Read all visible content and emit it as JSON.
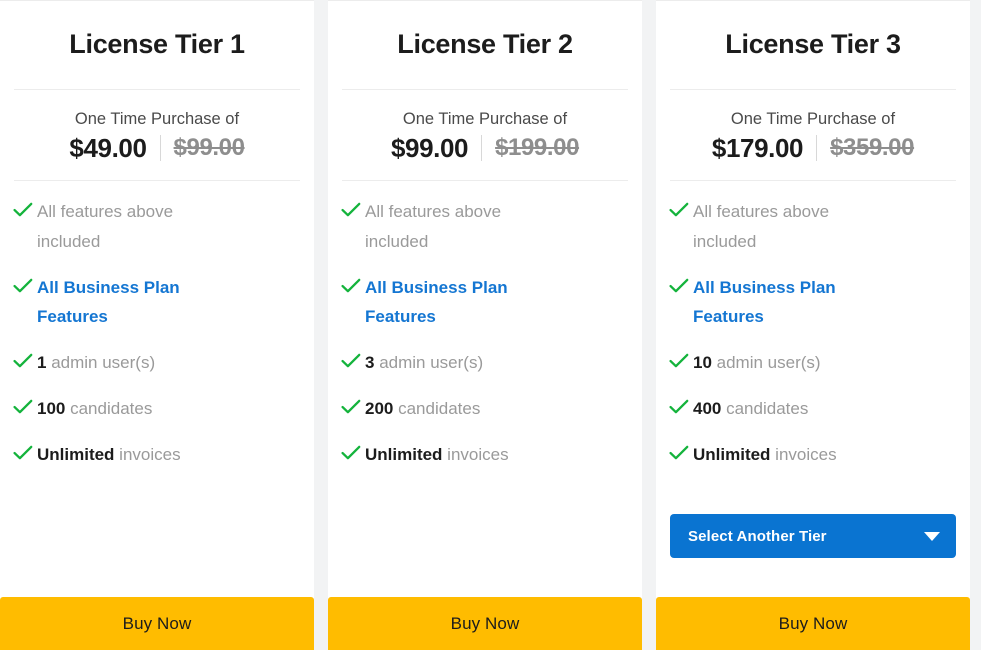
{
  "colors": {
    "check_green": "#14b33c",
    "link_blue": "#1476d2",
    "button_blue": "#0a74d1",
    "buy_yellow": "#ffbc00",
    "muted_text": "#9a9a9a",
    "page_background": "#f2f3f4"
  },
  "price_caption": "One Time Purchase of",
  "buy_label": "Buy Now",
  "tier_select_label": "Select Another Tier",
  "cards": [
    {
      "title": "License Tier 1",
      "price_caption": "One Time Purchase of",
      "price_now": "$49.00",
      "price_was": "$99.00",
      "features": [
        {
          "lead": "",
          "rest": "All features above included",
          "style": "muted"
        },
        {
          "lead": "",
          "rest": "All Business Plan Features",
          "style": "link"
        },
        {
          "lead": "1",
          "rest": " admin user(s)",
          "style": "muted"
        },
        {
          "lead": "100",
          "rest": " candidates",
          "style": "muted"
        },
        {
          "lead": "Unlimited",
          "rest": " invoices",
          "style": "muted"
        }
      ],
      "has_tier_select": false,
      "buy_label": "Buy Now"
    },
    {
      "title": "License Tier 2",
      "price_caption": "One Time Purchase of",
      "price_now": "$99.00",
      "price_was": "$199.00",
      "features": [
        {
          "lead": "",
          "rest": "All features above included",
          "style": "muted"
        },
        {
          "lead": "",
          "rest": "All Business Plan Features",
          "style": "link"
        },
        {
          "lead": "3",
          "rest": " admin user(s)",
          "style": "muted"
        },
        {
          "lead": "200",
          "rest": " candidates",
          "style": "muted"
        },
        {
          "lead": "Unlimited",
          "rest": " invoices",
          "style": "muted"
        }
      ],
      "has_tier_select": false,
      "buy_label": "Buy Now"
    },
    {
      "title": "License Tier 3",
      "price_caption": "One Time Purchase of",
      "price_now": "$179.00",
      "price_was": "$359.00",
      "features": [
        {
          "lead": "",
          "rest": "All features above included",
          "style": "muted"
        },
        {
          "lead": "",
          "rest": "All Business Plan Features",
          "style": "link"
        },
        {
          "lead": "10",
          "rest": " admin user(s)",
          "style": "muted"
        },
        {
          "lead": "400",
          "rest": " candidates",
          "style": "muted"
        },
        {
          "lead": "Unlimited",
          "rest": " invoices",
          "style": "muted"
        }
      ],
      "has_tier_select": true,
      "tier_select_label": "Select Another Tier",
      "buy_label": "Buy Now"
    }
  ]
}
